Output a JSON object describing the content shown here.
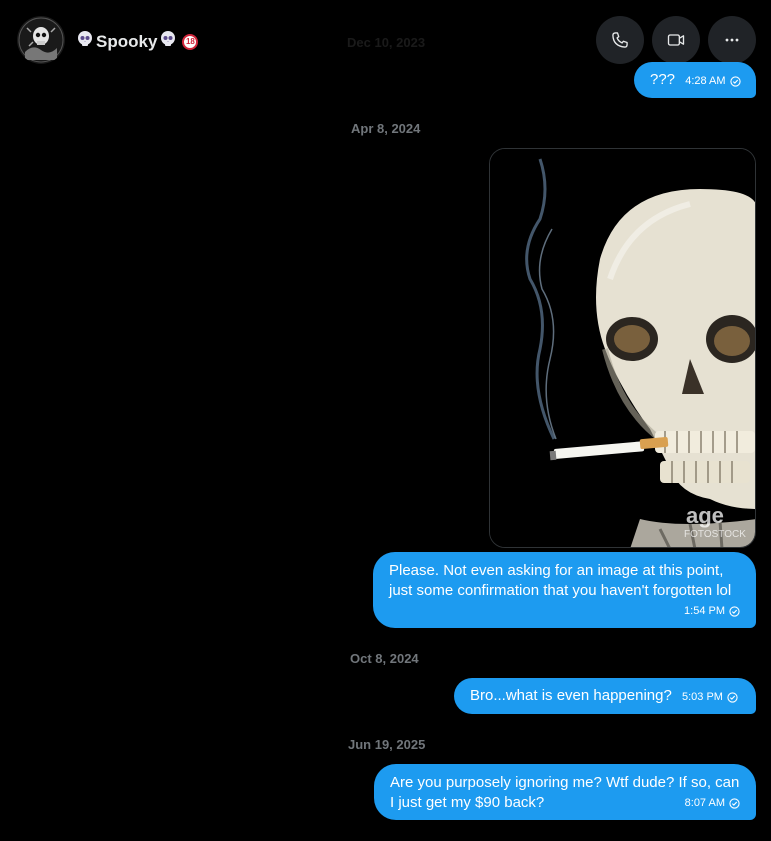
{
  "header": {
    "contact_name": "Spooky",
    "age_badge": "18",
    "buttons": [
      {
        "name": "phone-icon"
      },
      {
        "name": "video-icon"
      },
      {
        "name": "more-icon"
      }
    ]
  },
  "faded_date": "Dec 10, 2023",
  "messages": [
    {
      "text": "???",
      "time": "4:28 AM"
    },
    {
      "date": "Apr 8, 2024"
    },
    {
      "image": "skull-smoking-cigarette-photo",
      "watermark": "agefotostock",
      "watermark_sub": "FOTOSTOCK"
    },
    {
      "text": "Please. Not even asking for an image at this point, just some confirmation that you haven't forgotten lol",
      "time": "1:54 PM"
    },
    {
      "date": "Oct 8, 2024"
    },
    {
      "text": "Bro...what is even happening?",
      "time": "5:03 PM"
    },
    {
      "date": "Jun 19, 2025"
    },
    {
      "text": "Are you purposely ignoring me? Wtf dude? If so, can I just get my $90 back?",
      "time": "8:07 AM"
    }
  ],
  "colors": {
    "background": "#000000",
    "bubble": "#1d9bf0",
    "date_text": "#71767b",
    "button_bg": "#202327"
  }
}
